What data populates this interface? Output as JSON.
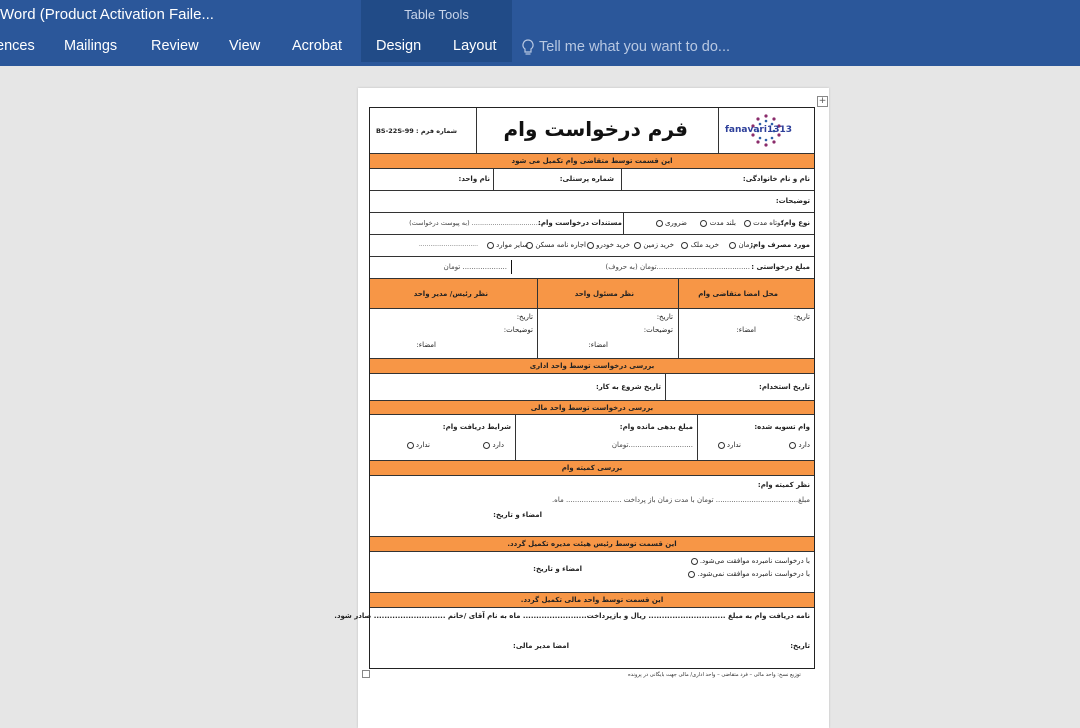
{
  "window": {
    "title": "Word (Product Activation Faile..."
  },
  "context_tab": {
    "label": "Table Tools"
  },
  "ribbon_tabs": [
    "ences",
    "Mailings",
    "Review",
    "View",
    "Acrobat",
    "Design",
    "Layout"
  ],
  "tell_me": {
    "placeholder": "Tell me what you want to do..."
  },
  "form": {
    "logo_text": "fanavari1313",
    "title": "فرم درخواست وام",
    "form_number": "شماره فرم : BS-22S-99",
    "sec_applicant": "این قسمت توسط متقاضی وام تکمیل می شود",
    "name_label": "نام و نام خانوادگی:",
    "personnel_label": "شماره پرسنلی:",
    "unit_label": "نام واحد:",
    "desc_label": "توضیحات:",
    "loan_type_label": "نوع وام:",
    "loan_type_options": [
      "کوتاه مدت",
      "بلند مدت",
      "ضروری"
    ],
    "docs_label": "مستندات درخواست وام:",
    "docs_hint": "................................... (به پیوست درخواست)",
    "usage_label": "مورد مصرف وام:",
    "usage_options": [
      "درمان",
      "خرید ملک",
      "خرید زمین",
      "خرید خودرو",
      "اجاره نامه مسکن",
      "سایر موارد"
    ],
    "usage_other_line": "...............................",
    "amount_label": "مبلغ درخواستی :",
    "amount_line": "..........................................تومان (به حروف)",
    "amount_num": ".................... تومان",
    "sign_applicant": "محل امضا متقاضی وام",
    "sign_manager": "نظر مسئول واحد",
    "sign_head": "نظر رئیس/ مدیر واحد",
    "date_label": "تاریخ:",
    "sign_label": "امضاء:",
    "comment_label": "توضیحات:",
    "sec_admin": "بررسی درخواست توسط واحد اداری",
    "hire_date_label": "تاریخ استخدام:",
    "start_date_label": "تاریخ شروع به کار:",
    "sec_finance": "بررسی درخواست توسط واحد مالی",
    "settled_label": "وام تسویه شده:",
    "debt_label": "مبلغ بدهی مانده وام:",
    "debt_line": ".............................تومان",
    "conditions_label": "شرایط دریافت وام:",
    "yes": "دارد",
    "no": "ندارد",
    "sec_committee": "بررسی کمیته وام",
    "committee_opinion": "نظر کمیته وام:",
    "committee_line": "مبلغ..................................... تومان با مدت زمان باز پرداخت ......................... ماه.",
    "sign_date_label": "امضاء و تاریخ:",
    "sec_board": "این قسمت توسط رئیس هیئت مدیره تکمیل گردد.",
    "board_approve": "با درخواست نامبرده موافقت می‌شود.",
    "board_reject": "با درخواست نامبرده موافقت نمی‌شود.",
    "sec_finance2": "این قسمت توسط واحد مالی تکمیل گردد.",
    "payment_line": "نامه دریافت وام به مبلغ ............................. ریال و بازپرداخت........................ ماه به نام آقای /خانم ........................... صادر شود.",
    "finance_sign": "امضا مدیر مالی:",
    "footer": "توزیع نسخ: واحد مالی – فرد متقاضی – واحد اداری/ مالی جهت بایگانی در پرونده"
  },
  "colors": {
    "ribbon": "#2b579a",
    "section": "#f79646"
  }
}
